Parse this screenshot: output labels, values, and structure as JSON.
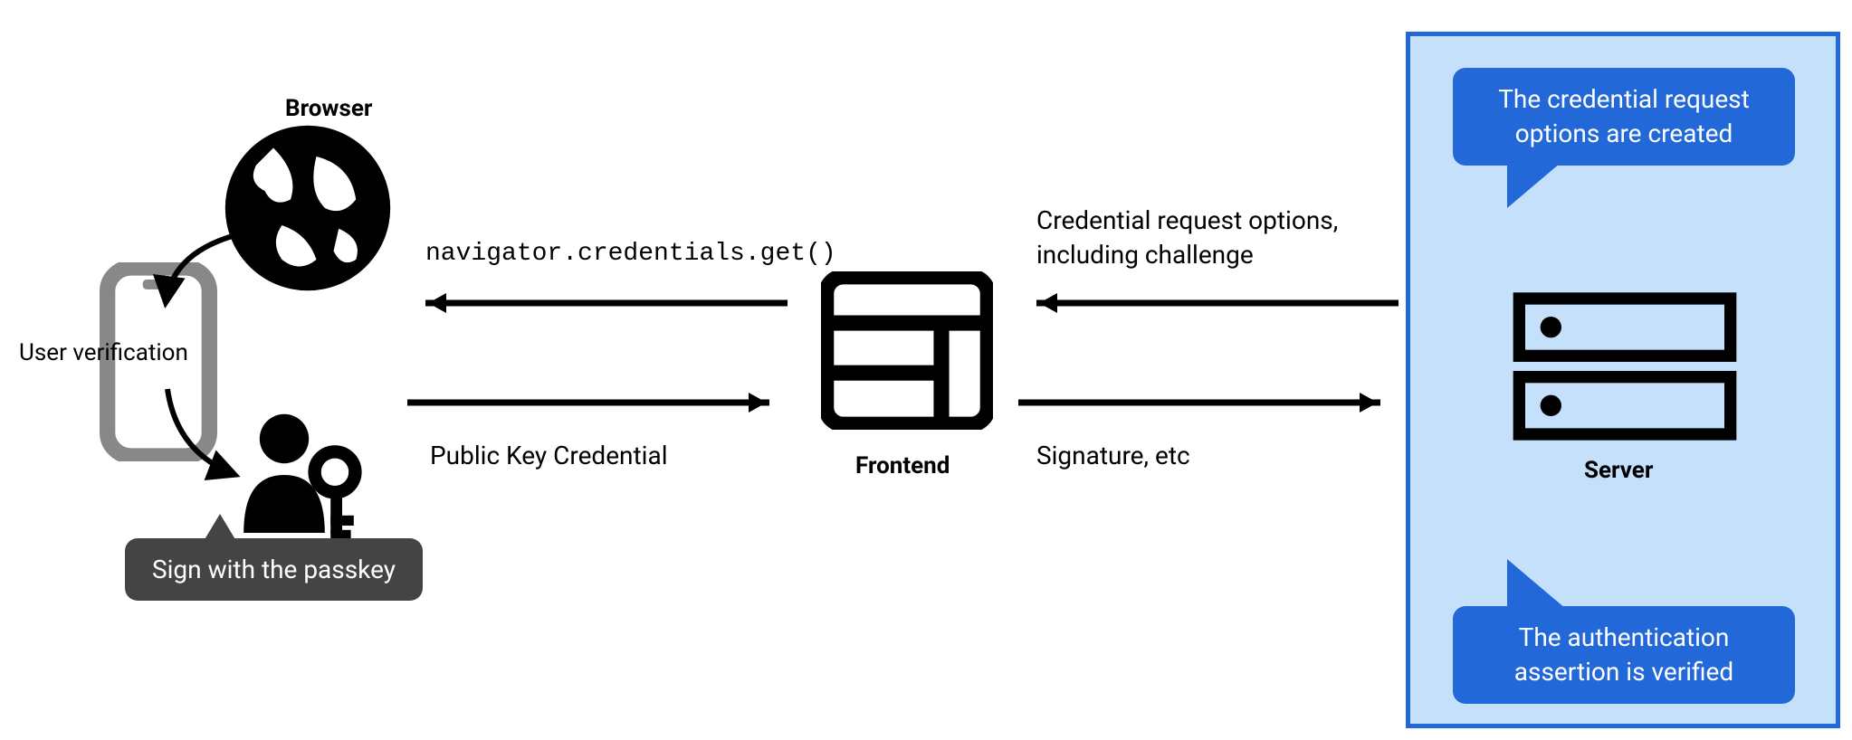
{
  "browser": {
    "label": "Browser",
    "user_verification": "User verification",
    "passkey_bubble": "Sign with the passkey"
  },
  "arrows": {
    "to_frontend_top": "navigator.credentials.get()",
    "to_browser_bottom": "Public Key Credential",
    "to_frontend_right_top": "Credential request options,\nincluding challenge",
    "to_server_right_bottom": "Signature, etc"
  },
  "frontend": {
    "label": "Frontend"
  },
  "server": {
    "label": "Server",
    "bubble_top": "The credential request options are created",
    "bubble_bottom": "The authentication assertion is verified"
  },
  "colors": {
    "server_box_fill": "#c5e0fb",
    "server_box_border": "#2268d8",
    "blue_bubble": "#2268d8",
    "gray_bubble": "#444444"
  }
}
